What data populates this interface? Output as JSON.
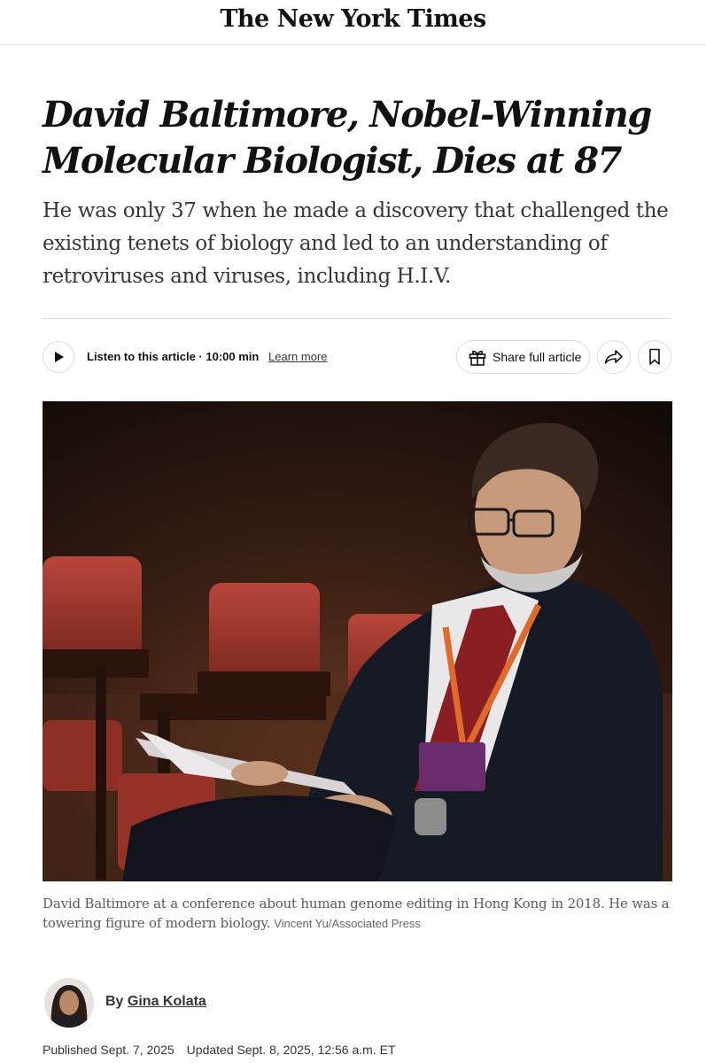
{
  "masthead": {
    "logo_text": "The New York Times"
  },
  "article": {
    "headline": "David Baltimore, Nobel-Winning Molecular Biologist, Dies at 87",
    "summary": "He was only 37 when he made a discovery that challenged the existing tenets of biology and led to an understanding of retroviruses and viruses, including H.I.V."
  },
  "toolbar": {
    "listen_label": "Listen to this article · 10:00 min",
    "learn_more": "Learn more",
    "share_label": "Share full article"
  },
  "photo": {
    "caption": "David Baltimore at a conference about human genome editing in Hong Kong in 2018. He was a towering figure of modern biology.",
    "credit": "Vincent Yu/Associated Press"
  },
  "byline": {
    "prefix": "By",
    "author": "Gina Kolata"
  },
  "dates": {
    "published": "Published Sept. 7, 2025",
    "updated": "Updated Sept. 8, 2025, 12:56 a.m. ET"
  },
  "icons": {
    "play": "play-icon",
    "gift": "gift-icon",
    "share": "share-arrow-icon",
    "bookmark": "bookmark-icon"
  },
  "colors": {
    "text": "#121212",
    "summary": "#363636",
    "caption": "#5a5a5a",
    "border": "#dcdcdc",
    "seat_red": "#a8352c"
  }
}
